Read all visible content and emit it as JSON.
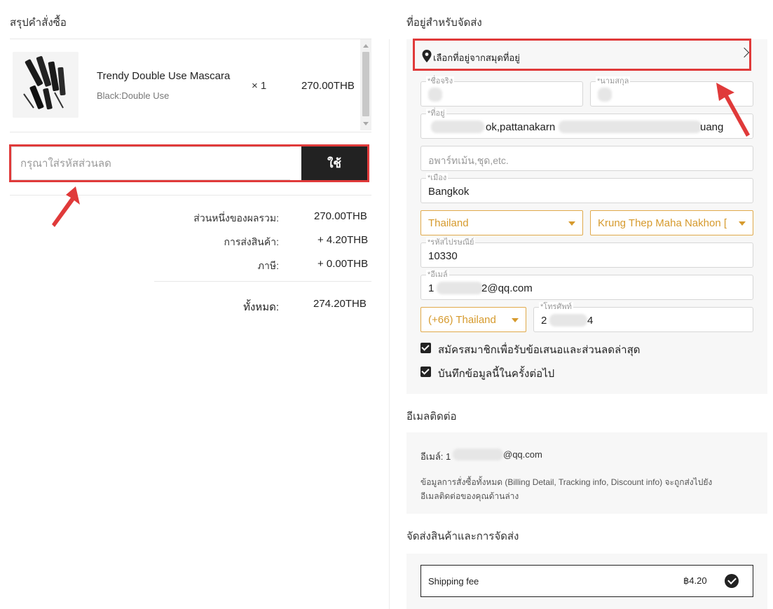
{
  "left": {
    "order_summary_title": "สรุปคำสั่งซื้อ",
    "product": {
      "name": "Trendy Double Use Mascara",
      "variant": "Black:Double Use",
      "qty": "× 1",
      "price": "270.00THB"
    },
    "coupon": {
      "placeholder": "กรุณาใส่รหัสส่วนลด",
      "apply_label": "ใช้"
    },
    "summary": {
      "subtotal_label": "ส่วนหนึ่งของผลรวม:",
      "subtotal_value": "270.00THB",
      "shipping_label": "การส่งสินค้า:",
      "shipping_value": "+ 4.20THB",
      "tax_label": "ภาษี:",
      "tax_value": "+ 0.00THB",
      "total_label": "ทั้งหมด:",
      "total_value": "274.20THB"
    }
  },
  "right": {
    "shipping_address_title": "ที่อยู่สำหรับจัดส่ง",
    "address_book_label": "เลือกที่อยู่จากสมุดที่อยู่",
    "first_name_label": "*ชื่อจริง",
    "last_name_label": "*นามสกุล",
    "address_label": "*ที่อยู่",
    "address_value_part1": "ok,pattanakarn",
    "address_value_part2": "uang",
    "address2_placeholder": "อพาร์ทเม้น,ชุด,etc.",
    "city_label": "*เมือง",
    "city_value": "Bangkok",
    "country_value": "Thailand",
    "state_value": "Krung Thep Maha Nakhon [",
    "zip_label": "*รหัสไปรษณีย์",
    "zip_value": "10330",
    "email_label": "*อีเมล์",
    "email_value_start": "1",
    "email_value_end": "2@qq.com",
    "phone_code_value": "(+66) Thailand",
    "phone_label": "*โทรศัพท์",
    "phone_value_start": "2",
    "phone_value_end": "4",
    "subscribe_label": "สมัครสมาชิกเพื่อรับข้อเสนอและส่วนลดล่าสุด",
    "save_info_label": "บันทึกข้อมูลนี้ในครั้งต่อไป",
    "contact_title": "อีเมลติดต่อ",
    "contact_email_prefix": "อีเมล์: 1",
    "contact_email_suffix": "@qq.com",
    "contact_note_line1": "ข้อมูลการสั่งซื้อทั้งหมด (Billing Detail, Tracking info, Discount info) จะถูกส่งไปยัง",
    "contact_note_line2": "อีเมลติดต่อของคุณด้านล่าง",
    "delivery_title": "จัดส่งสินค้าและการจัดส่ง",
    "shipping_option_label": "Shipping fee",
    "shipping_option_price": "฿4.20"
  },
  "colors": {
    "annotation_red": "#e03a3a",
    "accent_gold": "#d69a2d",
    "dark": "#222222"
  },
  "icons": [
    "location-pin-icon",
    "chevron-right-icon",
    "checkbox-checked-icon",
    "check-circle-icon"
  ]
}
